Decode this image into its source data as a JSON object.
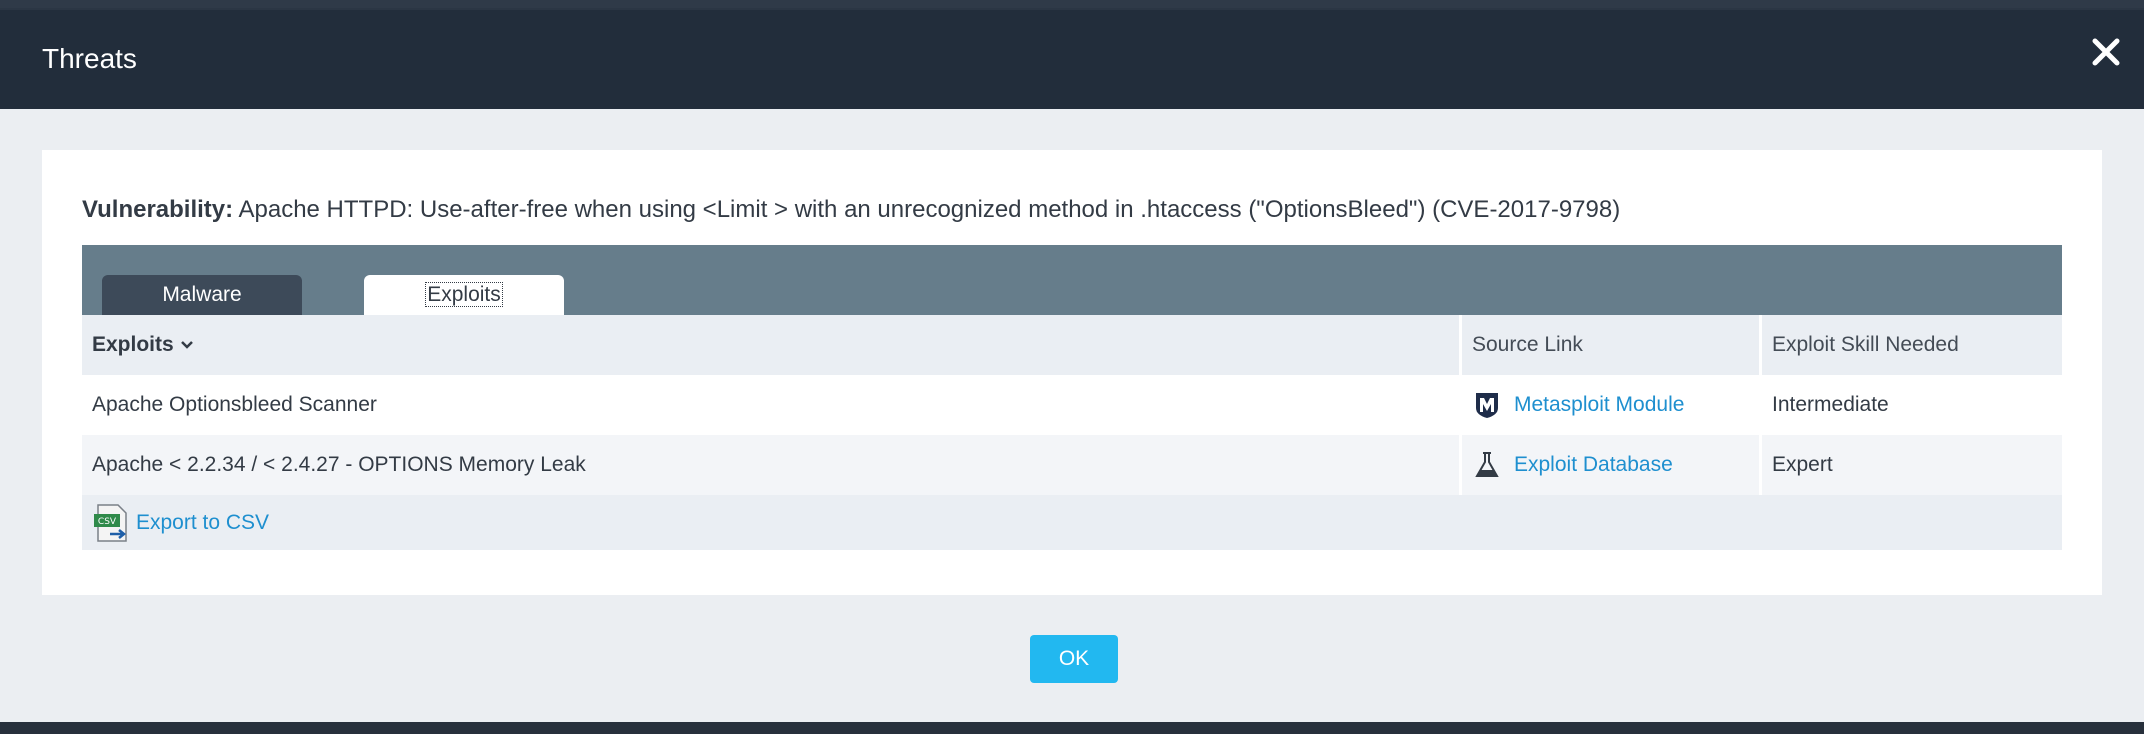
{
  "dialog": {
    "title": "Threats",
    "close_icon": "close-icon"
  },
  "vulnerability": {
    "label": "Vulnerability:",
    "text": "Apache HTTPD: Use-after-free when using <Limit > with an unrecognized method in .htaccess (\"OptionsBleed\") (CVE-2017-9798)"
  },
  "tabs": [
    {
      "label": "Malware",
      "active": false
    },
    {
      "label": "Exploits",
      "active": true
    }
  ],
  "table": {
    "columns": [
      "Exploits",
      "Source Link",
      "Exploit Skill Needed"
    ],
    "sort_icon": "chevron-down-icon",
    "rows": [
      {
        "exploit": "Apache Optionsbleed Scanner",
        "source": "Metasploit Module",
        "source_icon": "metasploit-icon",
        "skill": "Intermediate"
      },
      {
        "exploit": "Apache < 2.2.34 / < 2.4.27 - OPTIONS Memory Leak",
        "source": "Exploit Database",
        "source_icon": "exploit-db-icon",
        "skill": "Expert"
      }
    ],
    "export_label": "Export to CSV",
    "export_icon": "csv-file-icon"
  },
  "buttons": {
    "ok": "OK"
  },
  "colors": {
    "header_bg": "#222d3b",
    "tab_bar_bg": "#667d8b",
    "link": "#1e8fcf",
    "ok_button": "#22b8f0"
  }
}
